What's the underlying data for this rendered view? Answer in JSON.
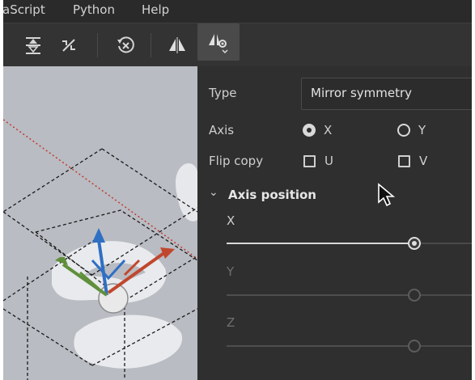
{
  "menubar": {
    "items": [
      "aScript",
      "Python",
      "Help"
    ]
  },
  "toolbar": {
    "icons": [
      "align-center-icon",
      "snap-off-icon",
      "reset-transform-icon",
      "symmetry-icon",
      "symmetry-settings-icon"
    ]
  },
  "panel": {
    "type_label": "Type",
    "type_value": "Mirror symmetry",
    "axis_label": "Axis",
    "axis_options": [
      {
        "label": "X",
        "selected": true
      },
      {
        "label": "Y",
        "selected": false
      }
    ],
    "flip_label": "Flip copy",
    "flip_options": [
      {
        "label": "U",
        "checked": false
      },
      {
        "label": "V",
        "checked": false
      }
    ],
    "section_title": "Axis position",
    "sliders": [
      {
        "label": "X",
        "enabled": true,
        "value": 0.7
      },
      {
        "label": "Y",
        "enabled": false,
        "value": 0.7
      },
      {
        "label": "Z",
        "enabled": false,
        "value": 0.7
      }
    ]
  },
  "colors": {
    "panel_bg": "#2f2f2f",
    "toolbar_bg": "#333333",
    "viewport_bg": "#b9bcc2",
    "gizmo_x": "#c0472d",
    "gizmo_y": "#5f8f3a",
    "gizmo_z": "#2f6fc4"
  }
}
